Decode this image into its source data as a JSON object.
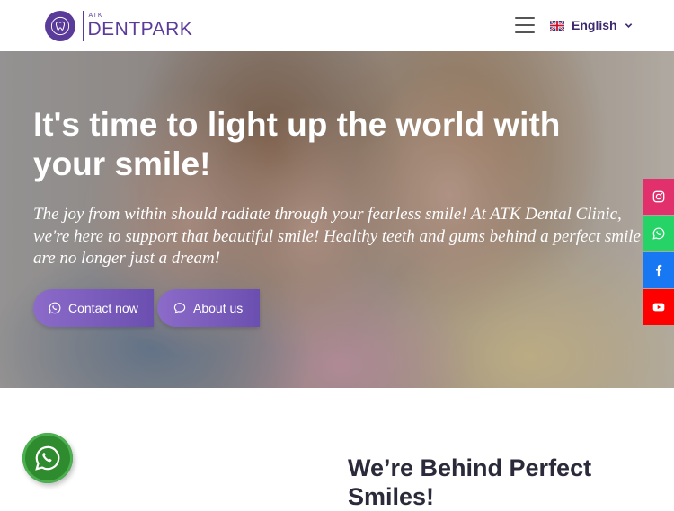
{
  "header": {
    "logo": {
      "small_text": "ATK",
      "brand_text": "DENTPARK"
    },
    "language": {
      "label": "English",
      "flag_icon": "uk-flag-icon"
    },
    "menu_icon": "hamburger-icon"
  },
  "hero": {
    "title": "It's time to light up the world with your smile!",
    "text": "The joy from within should radiate through your fearless smile! At ATK Dental Clinic, we're here to support that beautiful smile! Healthy teeth and gums behind a perfect smile are no longer just a dream!",
    "buttons": [
      {
        "label": "Contact now",
        "icon": "whatsapp-icon"
      },
      {
        "label": "About us",
        "icon": "chat-bubble-icon"
      }
    ]
  },
  "social": [
    {
      "name": "instagram",
      "icon": "instagram-icon",
      "color": "#e1306c"
    },
    {
      "name": "whatsapp",
      "icon": "whatsapp-icon",
      "color": "#25d366"
    },
    {
      "name": "facebook",
      "icon": "facebook-icon",
      "color": "#1877f2"
    },
    {
      "name": "youtube",
      "icon": "youtube-icon",
      "color": "#ff0000"
    }
  ],
  "section": {
    "title": "We’re Behind Perfect Smiles!"
  },
  "colors": {
    "brand": "#5b3b9a",
    "button": "#7a5cc0"
  }
}
